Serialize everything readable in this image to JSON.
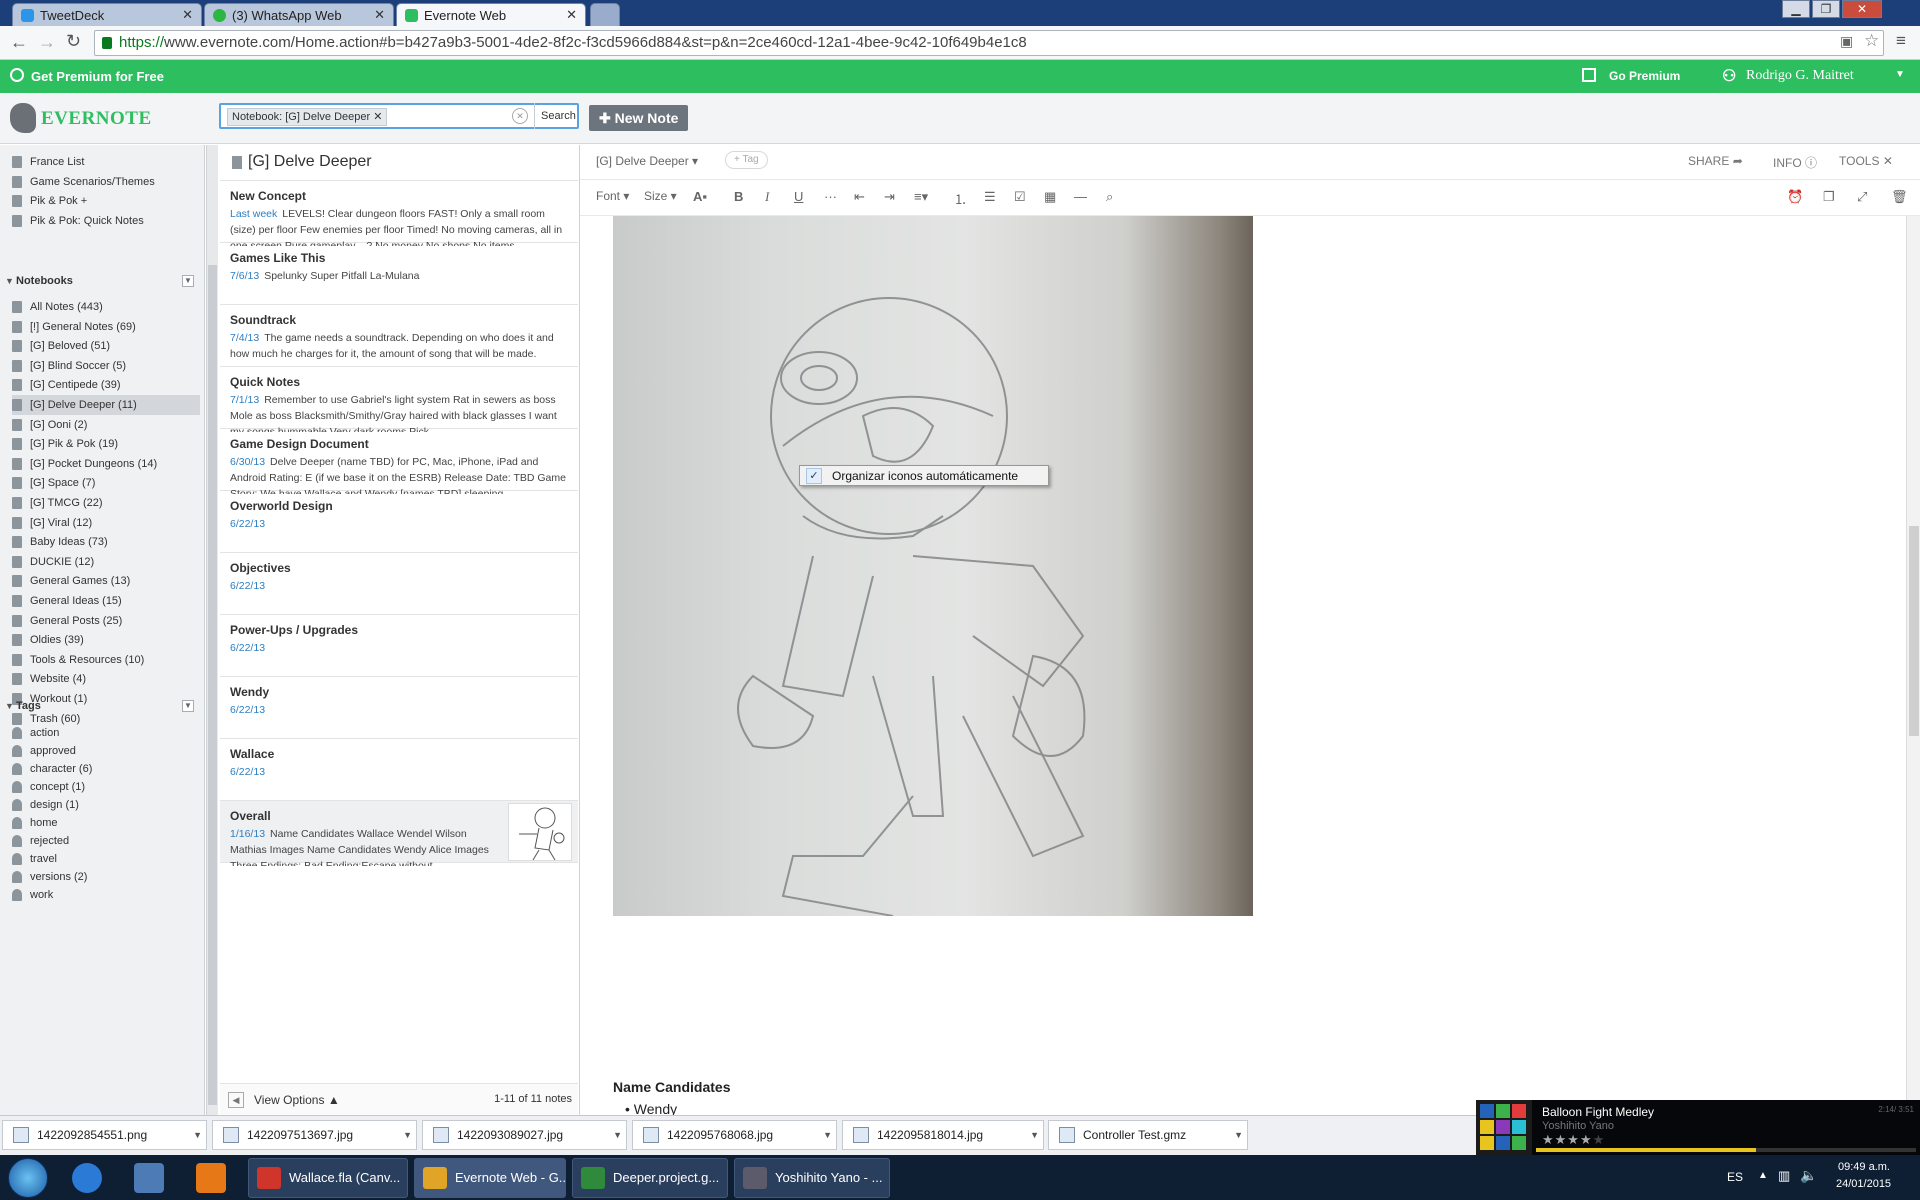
{
  "browser": {
    "tabs": [
      {
        "label": "TweetDeck",
        "color": "#2b95e9"
      },
      {
        "label": "(3) WhatsApp Web",
        "color": "#2bb741"
      },
      {
        "label": "Evernote Web",
        "color": "#2dbe60"
      }
    ],
    "url_scheme": "https://",
    "url_rest": "www.evernote.com/Home.action#b=b427a9b3-5001-4de2-8f2c-f3cd5966d884&st=p&n=2ce460cd-12a1-4bee-9c42-10f649b4e1c8"
  },
  "premium_bar": {
    "get_premium": "Get Premium for Free",
    "go_premium": "Go Premium",
    "user": "Rodrigo G. Maitret"
  },
  "header": {
    "logo": "EVERNOTE",
    "search_chip": "Notebook: [G] Delve Deeper",
    "search_button": "Search",
    "new_note": "New Note"
  },
  "sidebar": {
    "shortcuts": [
      "France List",
      "Game Scenarios/Themes",
      "Pik & Pok +",
      "Pik & Pok: Quick Notes"
    ],
    "notebooks_heading": "Notebooks",
    "notebooks": [
      "All Notes (443)",
      "[!] General Notes (69)",
      "[G] Beloved (51)",
      "[G] Blind Soccer (5)",
      "[G] Centipede (39)",
      "[G] Delve Deeper (11)",
      "[G] Ooni (2)",
      "[G] Pik & Pok (19)",
      "[G] Pocket Dungeons (14)",
      "[G] Space (7)",
      "[G] TMCG (22)",
      "[G] Viral (12)",
      "Baby Ideas (73)",
      "DUCKIE (12)",
      "General Games (13)",
      "General Ideas (15)",
      "General Posts (25)",
      "Oldies (39)",
      "Tools & Resources (10)",
      "Website (4)",
      "Workout (1)",
      "Trash (60)"
    ],
    "tags_heading": "Tags",
    "tags": [
      "action",
      "approved",
      "character (6)",
      "concept (1)",
      "design (1)",
      "home",
      "rejected",
      "travel",
      "versions (2)",
      "work"
    ]
  },
  "notelist": {
    "title": "[G] Delve Deeper",
    "notes": [
      {
        "title": "New Concept",
        "date": "Last week",
        "snippet": "LEVELS! Clear dungeon floors FAST! Only a small room (size) per floor Few enemies per floor Timed! No moving cameras, all in one screen Pure gameplay....? No money No shops No items"
      },
      {
        "title": "Games Like This",
        "date": "7/6/13",
        "snippet": "Spelunky Super Pitfall La-Mulana"
      },
      {
        "title": "Soundtrack",
        "date": "7/4/13",
        "snippet": "The game needs a soundtrack. Depending on who does it and how much he charges for it, the amount of song that will be made."
      },
      {
        "title": "Quick Notes",
        "date": "7/1/13",
        "snippet": "Remember to use Gabriel's light system Rat in sewers as boss Mole as boss Blacksmith/Smithy/Gray haired with black glasses I want my songs hummable Very dark rooms Pick"
      },
      {
        "title": "Game Design Document",
        "date": "6/30/13",
        "snippet": "Delve Deeper (name TBD) for PC, Mac, iPhone, iPad and Android Rating: E (if we base it on the ESRB) Release Date: TBD Game Story: We have Wallace and Wendy [names TBD] sleeping"
      },
      {
        "title": "Overworld Design",
        "date": "6/22/13",
        "snippet": ""
      },
      {
        "title": "Objectives",
        "date": "6/22/13",
        "snippet": ""
      },
      {
        "title": "Power-Ups / Upgrades",
        "date": "6/22/13",
        "snippet": ""
      },
      {
        "title": "Wendy",
        "date": "6/22/13",
        "snippet": ""
      },
      {
        "title": "Wallace",
        "date": "6/22/13",
        "snippet": ""
      },
      {
        "title": "Overall",
        "date": "1/16/13",
        "snippet": "Name Candidates Wallace Wendel Wilson Mathias Images Name Candidates Wendy Alice Images Three Endings: Bad Ending:Escape without"
      }
    ],
    "view_options": "View Options",
    "count": "1-11 of 11 notes"
  },
  "editor": {
    "notebook": "[G] Delve Deeper",
    "tag_button": "+ Tag",
    "share": "SHARE",
    "info": "INFO",
    "tools": "TOOLS",
    "font": "Font",
    "size": "Size",
    "context_menu": "Organizar iconos automáticamente",
    "heading": "Name Candidates",
    "bullet": "Wendy"
  },
  "downloads": [
    "1422092854551.png",
    "1422097513697.jpg",
    "1422093089027.jpg",
    "1422095768068.jpg",
    "1422095818014.jpg",
    "Controller Test.gmz"
  ],
  "taskbar": {
    "items": [
      "Wallace.fla (Canv...",
      "Evernote Web - G...",
      "Deeper.project.g...",
      "Yoshihito Yano - ..."
    ],
    "lang": "ES",
    "time": "09:49 a.m.",
    "date": "24/01/2015"
  },
  "player": {
    "song": "Balloon Fight Medley",
    "artist": "Yoshihito Yano",
    "time": "2:14/ 3:51"
  }
}
